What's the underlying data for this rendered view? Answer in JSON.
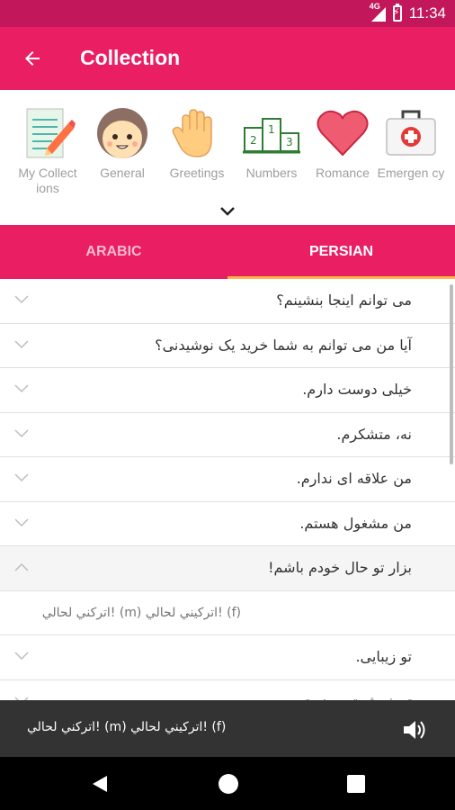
{
  "status_bar": {
    "network": "4G",
    "time": "11:34"
  },
  "toolbar": {
    "title": "Collection"
  },
  "categories": [
    {
      "label": "My Collect ions",
      "icon": "notebook-pencil-icon"
    },
    {
      "label": "General",
      "icon": "girl-face-icon"
    },
    {
      "label": "Greetings",
      "icon": "waving-hand-icon"
    },
    {
      "label": "Numbers",
      "icon": "podium-numbers-icon"
    },
    {
      "label": "Romance",
      "icon": "heart-icon"
    },
    {
      "label": "Emergen cy",
      "icon": "first-aid-kit-icon"
    }
  ],
  "tabs": {
    "arabic": "ARABIC",
    "persian": "PERSIAN",
    "selected": "PERSIAN"
  },
  "phrases": [
    {
      "text": "می توانم اینجا بنشینم؟"
    },
    {
      "text": "آیا من می توانم به شما خرید یک نوشیدنی؟"
    },
    {
      "text": "خیلی دوست دارم."
    },
    {
      "text": "نه، متشکرم."
    },
    {
      "text": "من علاقه ای ندارم."
    },
    {
      "text": "من مشغول هستم."
    },
    {
      "text": "بزار تو حال خودم باشم!",
      "expanded": true
    },
    {
      "text": "اتركني لحالي! (m)  اتركيني لحالي! (f)",
      "detail": true
    },
    {
      "text": "تو زیبایی."
    },
    {
      "text": "تو خوش تیپ هستی."
    }
  ],
  "player": {
    "text": "اتركني لحالي! (m)  اتركيني لحالي! (f)"
  },
  "colors": {
    "status_bar": "#c2185b",
    "primary": "#e91e63",
    "tab_indicator": "#ffb74d",
    "player_bg": "#333333"
  }
}
